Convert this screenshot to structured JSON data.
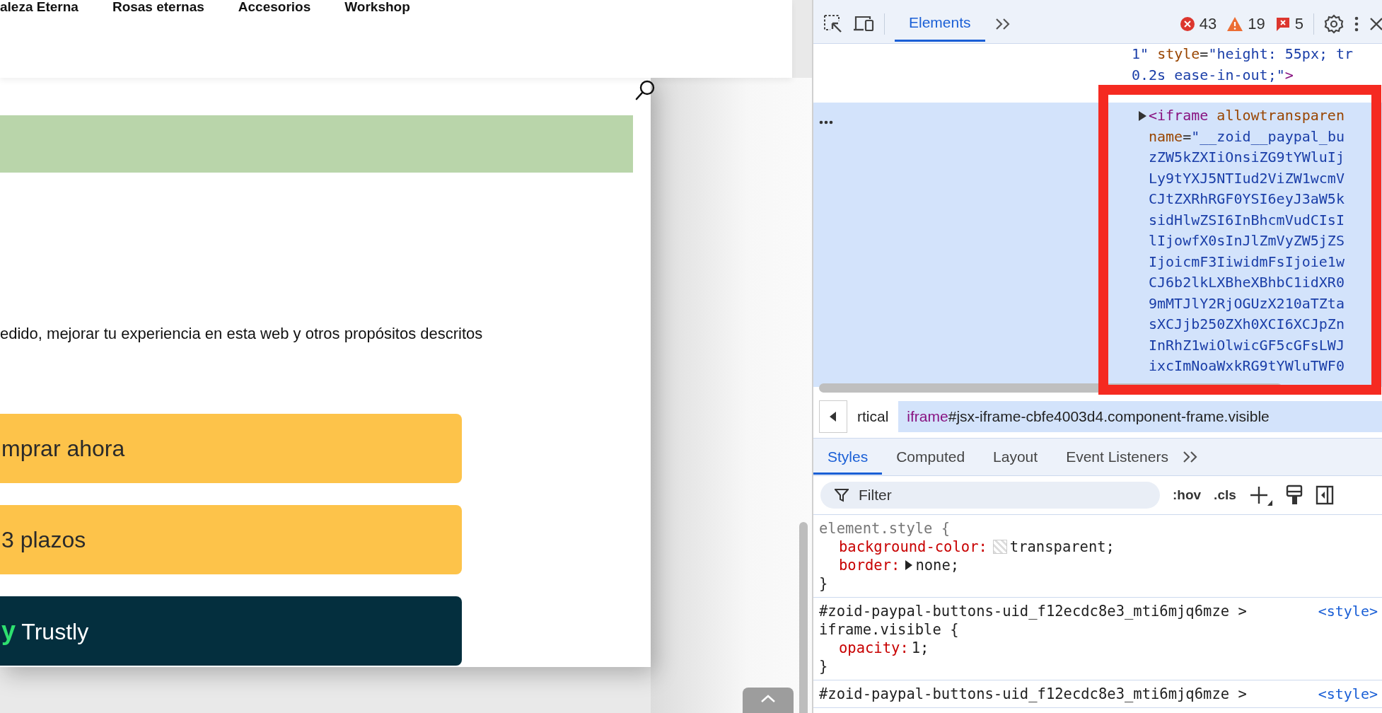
{
  "page": {
    "nav": [
      "aleza Eterna",
      "Rosas eternas",
      "Accesorios",
      "Workshop"
    ],
    "consent_text": "edido, mejorar tu experiencia en esta web y otros propósitos descritos",
    "pay_buttons": [
      {
        "kind": "paypal",
        "label": "mprar ahora"
      },
      {
        "kind": "paylater",
        "label": "3 plazos"
      },
      {
        "kind": "trustly",
        "logo": "y",
        "label": "Trustly"
      }
    ]
  },
  "devtools": {
    "tabs": [
      {
        "label": "Elements",
        "selected": true
      }
    ],
    "counts": {
      "errors": "43",
      "warnings": "19",
      "issues": "5"
    },
    "dom": [
      {
        "selected": false,
        "expandable": false,
        "lines": [
          [
            {
              "kind": "value",
              "text": "1\""
            },
            {
              "kind": "attr",
              "text": " style"
            },
            {
              "kind": "punct",
              "text": "="
            },
            {
              "kind": "value",
              "text": "\"height: 55px; tr"
            }
          ],
          [
            {
              "kind": "value",
              "text": "0.2s ease-in-out;\""
            },
            {
              "kind": "tag",
              "text": ">"
            }
          ]
        ]
      },
      {
        "selected": true,
        "expandable": true,
        "lines": [
          [
            {
              "kind": "tag",
              "text": "<iframe"
            },
            {
              "kind": "attr",
              "text": " allowtransparen"
            }
          ],
          [
            {
              "kind": "attr",
              "text": "name"
            },
            {
              "kind": "punct",
              "text": "="
            },
            {
              "kind": "value",
              "text": "\"__zoid__paypal_bu"
            }
          ],
          [
            {
              "kind": "value",
              "text": "zZW5kZXIiOnsiZG9tYWluIj"
            }
          ],
          [
            {
              "kind": "value",
              "text": "Ly9tYXJ5NTIud2ViZW1wcmV"
            }
          ],
          [
            {
              "kind": "value",
              "text": "CJtZXRhRGF0YSI6eyJ3aW5k"
            }
          ],
          [
            {
              "kind": "value",
              "text": "sidHlwZSI6InBhcmVudCIsI"
            }
          ],
          [
            {
              "kind": "value",
              "text": "lIjowfX0sInJlZmVyZW5jZS"
            }
          ],
          [
            {
              "kind": "value",
              "text": "IjoicmF3IiwidmFsIjoie1w"
            }
          ],
          [
            {
              "kind": "value",
              "text": "CJ6b2lkLXBheXBhbC1idXR0"
            }
          ],
          [
            {
              "kind": "value",
              "text": "9mMTJlY2RjOGUzX210aTZta"
            }
          ],
          [
            {
              "kind": "value",
              "text": "sXCJjb250ZXh0XCI6XCJpZn"
            }
          ],
          [
            {
              "kind": "value",
              "text": "InRhZ1wiOlwicGF5cGFsLWJ"
            }
          ],
          [
            {
              "kind": "value",
              "text": "ixcImNoaWxkRG9tYWluTWF0"
            }
          ]
        ]
      }
    ],
    "breadcrumbs": [
      {
        "text": "rtical",
        "selected": false
      },
      {
        "tag": "iframe",
        "text": "#jsx-iframe-cbfe4003d4.component-frame.visible",
        "selected": true
      }
    ],
    "styles_tabs": [
      {
        "label": "Styles",
        "selected": true
      },
      {
        "label": "Computed",
        "selected": false
      },
      {
        "label": "Layout",
        "selected": false
      },
      {
        "label": "Event Listeners",
        "selected": false
      }
    ],
    "filter": {
      "placeholder": "Filter"
    },
    "toggles": [
      ":hov",
      ".cls"
    ],
    "rules": [
      {
        "kind": "inline",
        "selector": [
          "element.style {"
        ],
        "declarations": [
          {
            "kind": "color",
            "property": "background-color:",
            "value": "transparent;"
          },
          {
            "kind": "shorthand",
            "property": "border:",
            "value": "none;"
          }
        ],
        "close": "}"
      },
      {
        "kind": "css",
        "selector": [
          "#zoid-paypal-buttons-uid_f12ecdc8e3_mti6mjq6mze >",
          "iframe.visible {"
        ],
        "source": "<style>",
        "declarations": [
          {
            "kind": "plain",
            "property": "opacity:",
            "value": "1;"
          }
        ],
        "close": "}"
      },
      {
        "kind": "css",
        "selector": [
          "#zoid-paypal-buttons-uid_f12ecdc8e3_mti6mjq6mze >"
        ],
        "source": "<style>"
      }
    ]
  }
}
